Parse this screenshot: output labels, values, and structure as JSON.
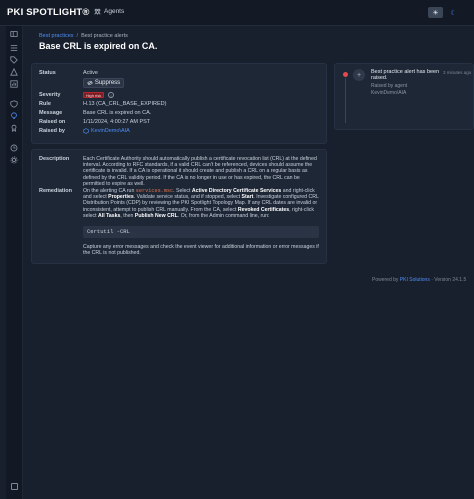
{
  "app": {
    "logo": "PKI SPOTLIGHT®"
  },
  "nav": {
    "agents": "Agents"
  },
  "theme": {
    "light_icon": "☀",
    "dark_icon": "☾"
  },
  "breadcrumb": {
    "root": "Best practices",
    "current": "Best practice alerts"
  },
  "page": {
    "title": "Base CRL is expired on CA."
  },
  "details": {
    "status_label": "Status",
    "status_value": "Active",
    "suppress_label": "Suppress",
    "severity_label": "Severity",
    "severity_value": "High risk",
    "rule_label": "Rule",
    "rule_value": "H.13 (CA_CRL_BASE_EXPIRED)",
    "message_label": "Message",
    "message_value": "Base CRL is expired on CA.",
    "raised_on_label": "Raised on",
    "raised_on_value": "1/11/2024, 4:00:27 AM PST",
    "raised_by_label": "Raised by",
    "raised_by_value": "KevinDemo\\AIA"
  },
  "description": {
    "label": "Description",
    "text": "Each Certificate Authority should automatically publish a certificate revocation list (CRL) at the defined interval. According to RFC standards, if a valid CRL can't be referenced, devices should assume the certificate is invalid. If a CA is operational it should create and publish a CRL on a regular basis as defined by the CRL validity period. If the CA is no longer in use or has expired, the CRL can be permitted to expire as well."
  },
  "remediation": {
    "label": "Remediation",
    "p1": "On the alerting CA run",
    "cmd": "services.msc",
    "p2": ". Select",
    "b1": "Active Directory Certificate Services",
    "p3": "and right-click and select",
    "b2": "Properties",
    "p4": ". Validate service status, and if stopped, select",
    "b3": "Start",
    "p5": ". Investigate configured CRL Distribution Points (CDP) by reviewing the PKI Spotlight Topology Map. If any CRL dates are invalid or inconsistent, attempt to publish CRL manually. From the CA, select",
    "b4": "Revoked Certificates",
    "p6": ", right-click select",
    "b5": "All Tasks",
    "p7": ", then",
    "b6": "Publish New CRL",
    "p8": ". Or, from the Admin command line, run:",
    "code": "Certutil -CRL",
    "after": "Capture any error messages and check the event viewer for additional information or error messages if the CRL is not published."
  },
  "activity": {
    "title": "Best practice alert has been raised.",
    "time": "3 minutes ago",
    "by_label": "Raised by agent",
    "by_value": "KevinDemo\\AIA"
  },
  "footer": {
    "powered_by": "Powered by",
    "company": "PKI Solutions",
    "version": "Version 24.1.5"
  }
}
